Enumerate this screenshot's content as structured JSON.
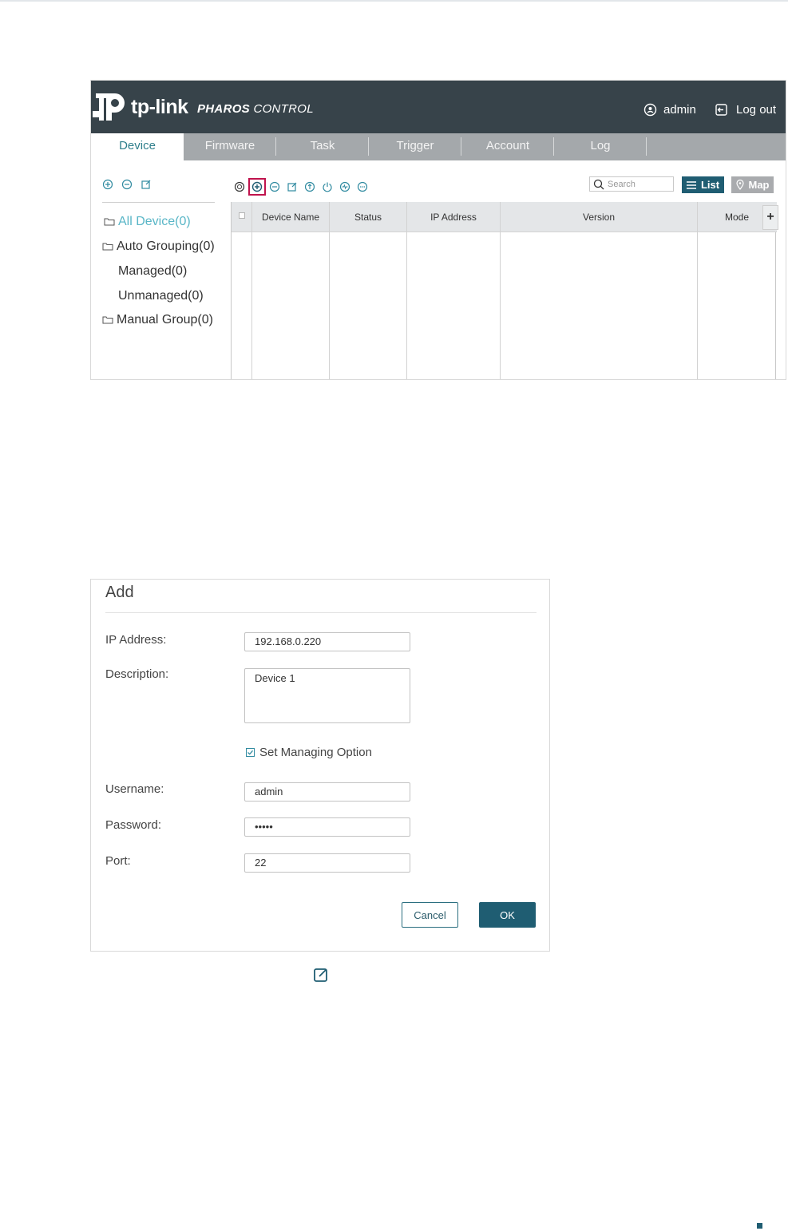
{
  "app": {
    "brand": "tp-link",
    "product_bold": "PHAROS",
    "product_light": " CONTROL",
    "user": "admin",
    "logout": "Log out",
    "tabs": [
      {
        "label": "Device"
      },
      {
        "label": "Firmware"
      },
      {
        "label": "Task"
      },
      {
        "label": "Trigger"
      },
      {
        "label": "Account"
      },
      {
        "label": "Log"
      }
    ],
    "tree": {
      "all": "All Device(0)",
      "auto": "Auto Grouping(0)",
      "managed": "Managed(0)",
      "unmanaged": "Unmanaged(0)",
      "manual": "Manual Group(0)"
    },
    "search_placeholder": "Search",
    "list_label": "List",
    "map_label": "Map",
    "columns": [
      "Device Name",
      "Status",
      "IP Address",
      "Version",
      "Mode"
    ],
    "add_column": "+",
    "colors": {
      "header": "#37434a",
      "accent": "#1f5d72",
      "active_tab_text": "#2f7f8c",
      "highlight": "#c0134d"
    }
  },
  "dialog": {
    "title": "Add",
    "ip_label": "IP Address:",
    "ip_value": "192.168.0.220",
    "desc_label": "Description:",
    "desc_value": "Device 1",
    "option_label": "Set Managing Option",
    "option_checked": true,
    "username_label": "Username:",
    "username_value": "admin",
    "password_label": "Password:",
    "password_value": "•••••",
    "port_label": "Port:",
    "port_value": "22",
    "cancel": "Cancel",
    "ok": "OK"
  }
}
